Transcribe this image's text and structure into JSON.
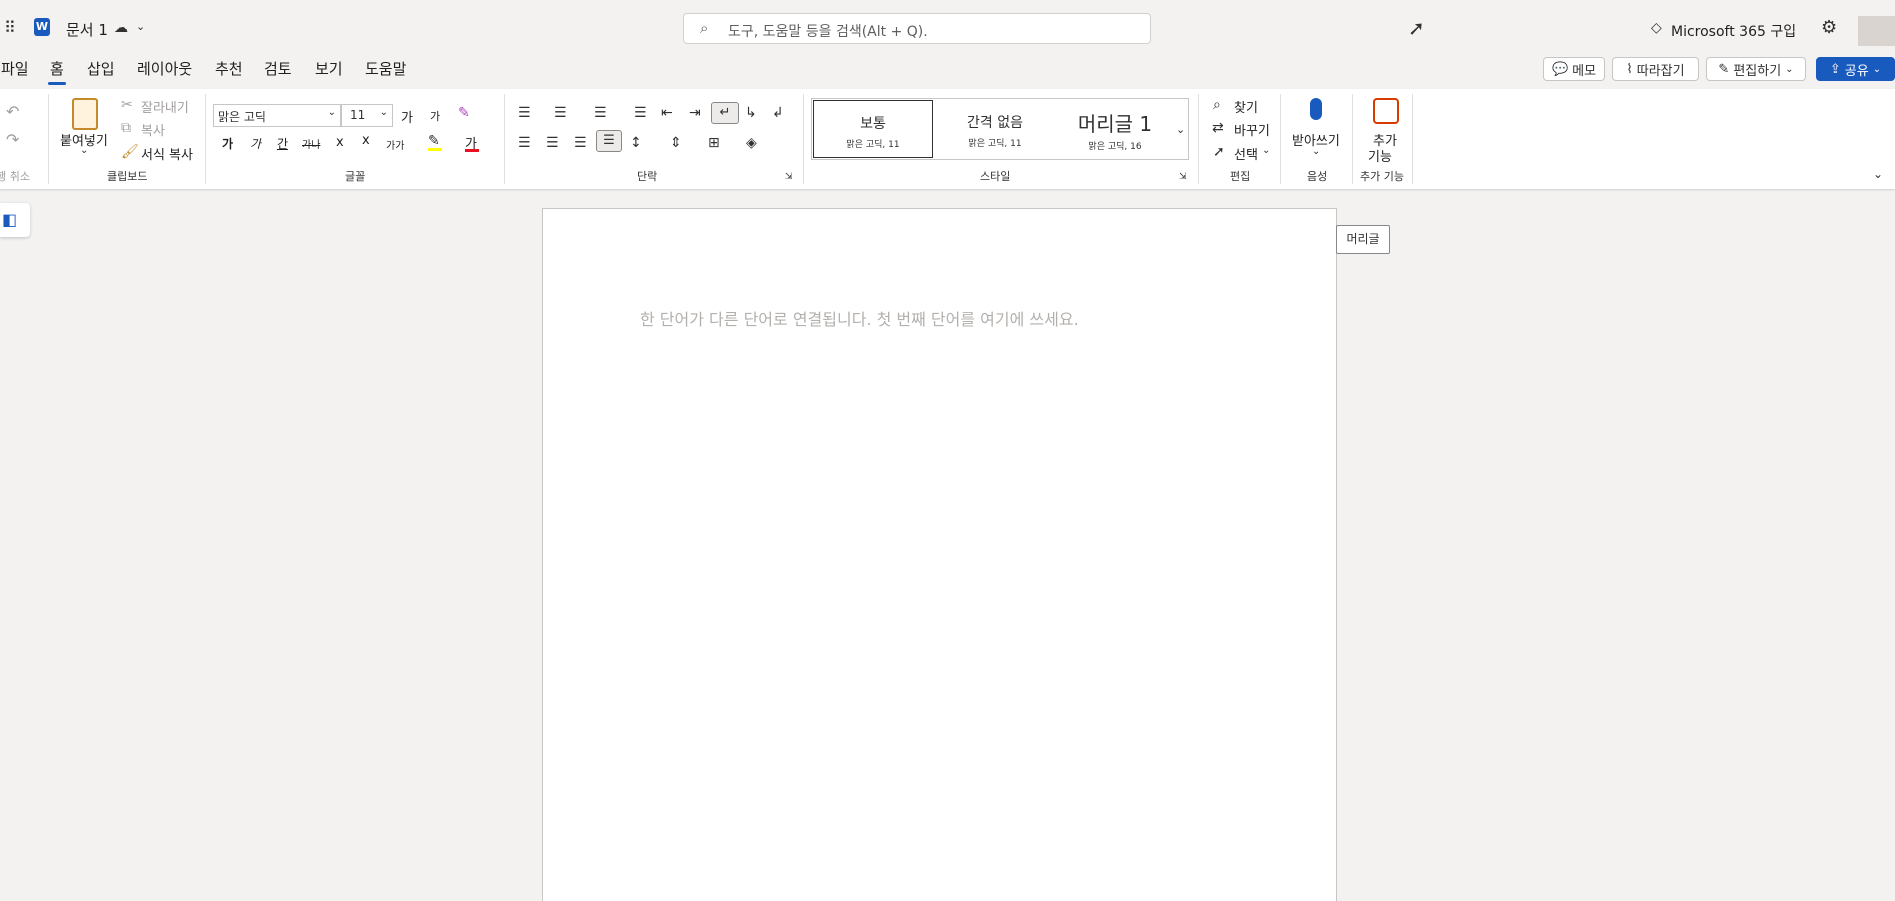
{
  "app": {
    "doc_title": "문서 1",
    "buy_label": "Microsoft 365 구입"
  },
  "search": {
    "placeholder": "도구, 도움말 등을 검색(Alt + Q)."
  },
  "menu": {
    "tabs": [
      "파일",
      "홈",
      "삽입",
      "레이아웃",
      "추천",
      "검토",
      "보기",
      "도움말"
    ],
    "active": "홈",
    "comment": "메모",
    "track": "따라잡기",
    "editing": "편집하기",
    "share": "공유"
  },
  "ribbon": {
    "undo_group": "실행 취소",
    "clipboard": {
      "paste": "붙여넣기",
      "cut": "잘라내기",
      "copy": "복사",
      "format_painter": "서식 복사",
      "label": "클립보드"
    },
    "font": {
      "family": "맑은 고딕",
      "size": "11",
      "grow": "가",
      "shrink": "가",
      "bold": "가",
      "italic": "가",
      "underline": "간",
      "strike": "가나",
      "sub": "x",
      "sup": "x",
      "case": "가가",
      "fontcolor": "가",
      "label": "글꼴"
    },
    "paragraph": {
      "label": "단락"
    },
    "styles": {
      "items": [
        {
          "name": "보통",
          "desc": "맑은 고딕, 11"
        },
        {
          "name": "간격 없음",
          "desc": "맑은 고딕, 11"
        },
        {
          "name": "머리글 1",
          "desc": "맑은 고딕, 16"
        }
      ],
      "label": "스타일"
    },
    "editing": {
      "find": "찾기",
      "replace": "바꾸기",
      "select": "선택",
      "label": "편집"
    },
    "voice": {
      "dictate": "받아쓰기",
      "label": "음성"
    },
    "addins": {
      "btn_line1": "추가",
      "btn_line2": "기능",
      "label": "추가 기능"
    }
  },
  "document": {
    "placeholder": "한 단어가 다른 단어로 연결됩니다. 첫 번째 단어를 여기에 쓰세요.",
    "header_tip": "머리글"
  },
  "colors": {
    "accent": "#185abd",
    "share_bg": "#185abd",
    "highlight": "#ffff00",
    "fontcolor": "#e81123",
    "addins": "#d83b01"
  }
}
